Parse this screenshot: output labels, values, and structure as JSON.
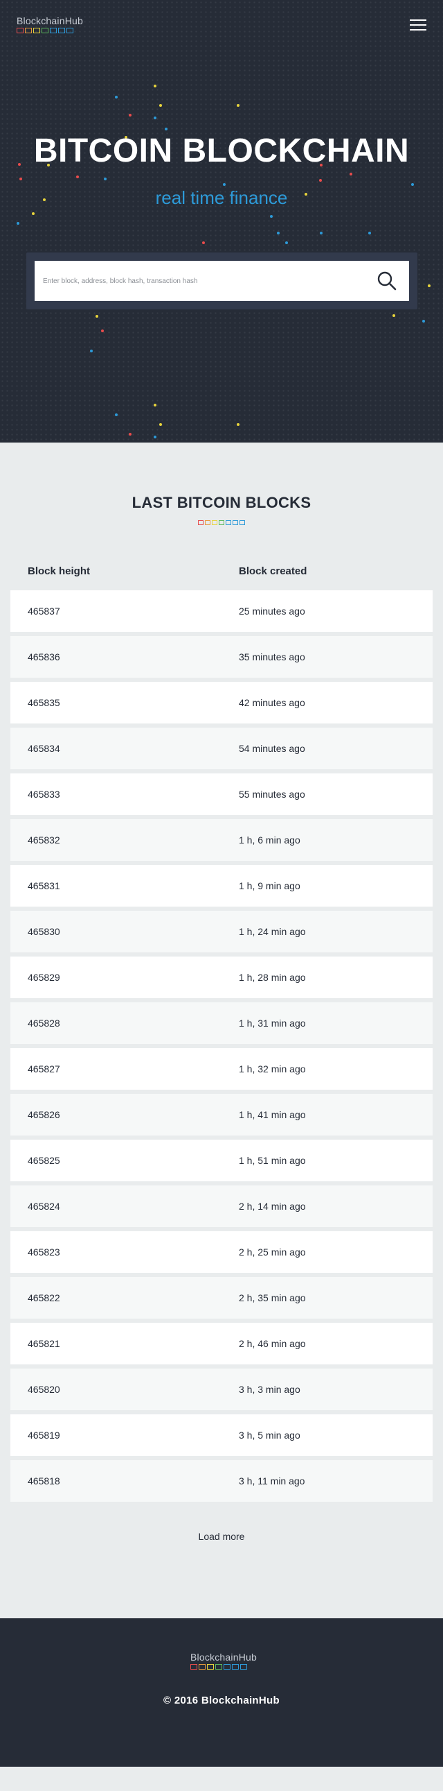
{
  "brand": {
    "name": "BlockchainHub",
    "block_colors": [
      "#e84c4c",
      "#e89a3c",
      "#e8d43c",
      "#5cb85c",
      "#2d9ad8",
      "#2d9ad8",
      "#2d9ad8"
    ]
  },
  "header": {
    "menu_icon": "hamburger-menu-icon"
  },
  "hero": {
    "title": "BITCOIN BLOCKCHAIN",
    "subtitle": "real time finance",
    "search_placeholder": "Enter block, address, block hash, transaction hash",
    "search_icon": "search-icon"
  },
  "blocks": {
    "title": "LAST BITCOIN BLOCKS",
    "columns": {
      "height": "Block height",
      "created": "Block created"
    },
    "rows": [
      {
        "height": "465837",
        "created": "25 minutes ago"
      },
      {
        "height": "465836",
        "created": "35 minutes ago"
      },
      {
        "height": "465835",
        "created": "42 minutes ago"
      },
      {
        "height": "465834",
        "created": "54 minutes ago"
      },
      {
        "height": "465833",
        "created": "55 minutes ago"
      },
      {
        "height": "465832",
        "created": "1 h, 6 min ago"
      },
      {
        "height": "465831",
        "created": "1 h, 9 min ago"
      },
      {
        "height": "465830",
        "created": "1 h, 24 min ago"
      },
      {
        "height": "465829",
        "created": "1 h, 28 min ago"
      },
      {
        "height": "465828",
        "created": "1 h, 31 min ago"
      },
      {
        "height": "465827",
        "created": "1 h, 32 min ago"
      },
      {
        "height": "465826",
        "created": "1 h, 41 min ago"
      },
      {
        "height": "465825",
        "created": "1 h, 51 min ago"
      },
      {
        "height": "465824",
        "created": "2 h, 14 min ago"
      },
      {
        "height": "465823",
        "created": "2 h, 25 min ago"
      },
      {
        "height": "465822",
        "created": "2 h, 35 min ago"
      },
      {
        "height": "465821",
        "created": "2 h, 46 min ago"
      },
      {
        "height": "465820",
        "created": "3 h, 3 min ago"
      },
      {
        "height": "465819",
        "created": "3 h, 5 min ago"
      },
      {
        "height": "465818",
        "created": "3 h, 11 min ago"
      }
    ],
    "load_more": "Load more"
  },
  "footer": {
    "copyright": "© 2016 BlockchainHub"
  },
  "colors": {
    "dark_bg": "#262c37",
    "accent_blue": "#2d9ad8",
    "light_bg": "#e9eced",
    "search_frame": "#323a4c"
  }
}
